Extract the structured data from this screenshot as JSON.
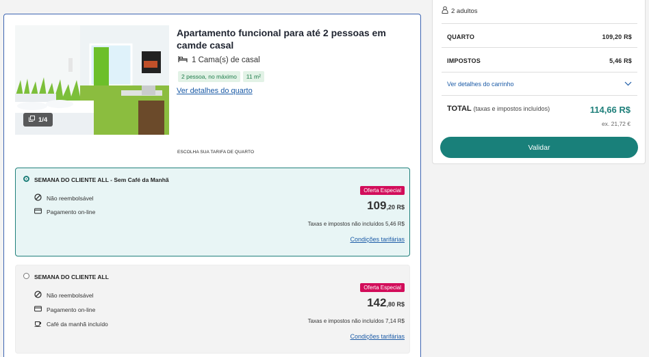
{
  "room": {
    "title": "Apartamento funcional para até 2 pessoas em camde casal",
    "bed": "1 Cama(s) de casal",
    "tags": [
      "2 pessoa, no máximo",
      "11 m²"
    ],
    "details_link": "Ver detalhes do quarto",
    "photo_counter": "1/4",
    "rate_heading": "ESCOLHA SUA TARIFA DE QUARTO"
  },
  "rates": [
    {
      "name": "SEMANA DO CLIENTE ALL - Sem Café da Manhã",
      "selected": true,
      "features": [
        {
          "icon": "no-refund-icon",
          "label": "Não reembolsável"
        },
        {
          "icon": "credit-card-icon",
          "label": "Pagamento on-line"
        }
      ],
      "badge": "Oferta Especial",
      "price_int": "109",
      "price_cents": ",20 R$",
      "tax_note": "Taxas e impostos não incluídos 5,46 R$",
      "conditions": "Condições tarifárias"
    },
    {
      "name": "SEMANA DO CLIENTE ALL",
      "selected": false,
      "features": [
        {
          "icon": "no-refund-icon",
          "label": "Não reembolsável"
        },
        {
          "icon": "credit-card-icon",
          "label": "Pagamento on-line"
        },
        {
          "icon": "coffee-cup-icon",
          "label": "Café da manhã incluído"
        }
      ],
      "badge": "Oferta Especial",
      "price_int": "142",
      "price_cents": ",80 R$",
      "tax_note": "Taxas e impostos não incluídos 7,14 R$",
      "conditions": "Condições tarifárias"
    }
  ],
  "cart": {
    "guests": "2 adultos",
    "room_label": "QUARTO",
    "room_value": "109,20 R$",
    "tax_label": "IMPOSTOS",
    "tax_value": "5,46 R$",
    "details_link": "Ver detalhes do carrinho",
    "total_label": "TOTAL",
    "total_note": "(taxas e impostos incluídos)",
    "total_value": "114,66 R$",
    "total_ex": "ex. 21,72 €",
    "validate_button": "Validar"
  },
  "colors": {
    "accent": "#19807a",
    "link": "#1a5aa6",
    "badge": "#d20d5a",
    "selected_bg": "#e8f5f5"
  }
}
